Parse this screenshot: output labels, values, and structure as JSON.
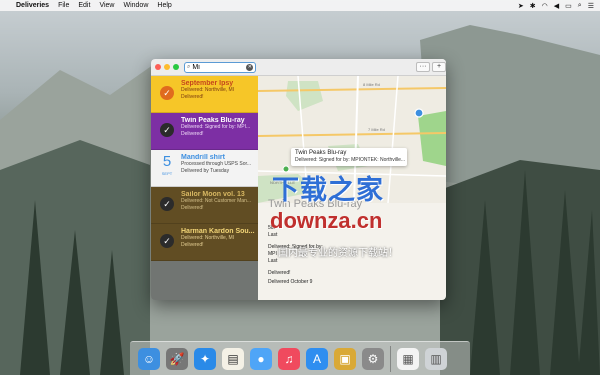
{
  "menubar": {
    "app_name": "Deliveries",
    "menus": [
      "File",
      "Edit",
      "View",
      "Window",
      "Help"
    ]
  },
  "search": {
    "value": "Mi"
  },
  "deliveries": [
    {
      "title": "September Ipsy",
      "line1": "Delivered: Northville, MI",
      "line2": "Delivered!"
    },
    {
      "title": "Twin Peaks Blu-ray",
      "line1": "Delivered: Signed for by: MPI...",
      "line2": "Delivered!"
    },
    {
      "title": "Mandrill shirt",
      "line1": "Processed through USPS Sor...",
      "line2": "Delivered by Tuesday",
      "day": "5",
      "month": "SEPT"
    },
    {
      "title": "Sailor Moon vol. 13",
      "line1": "Delivered: Not Customer Man...",
      "line2": "Delivered!"
    },
    {
      "title": "Harman Kardon Sou...",
      "line1": "Delivered: Northville, MI",
      "line2": "Delivered!"
    }
  ],
  "detail": {
    "toolbar": {
      "more": "···",
      "add": "+"
    },
    "map": {
      "roads": [
        "8 Mile Rd",
        "7 Mile Rd"
      ],
      "area_label": "NORTHVILLE"
    },
    "callout": {
      "title": "Twin Peaks Blu-ray",
      "subtitle": "Delivered: Signed for by: MPIONTEK: Northville..."
    },
    "title": "Twin Peaks Blu-ray",
    "tracking": "502",
    "last_updated_1": "Last",
    "status_lines": [
      "Delivered: Signed for by:",
      "MPI",
      "Last"
    ],
    "delivered": "Delivered!",
    "delivered_date": "Delivered October 9"
  },
  "watermark": {
    "line1": "下载之家",
    "line2": "downza.cn",
    "line3": "国内最专业的资源下载站！"
  }
}
